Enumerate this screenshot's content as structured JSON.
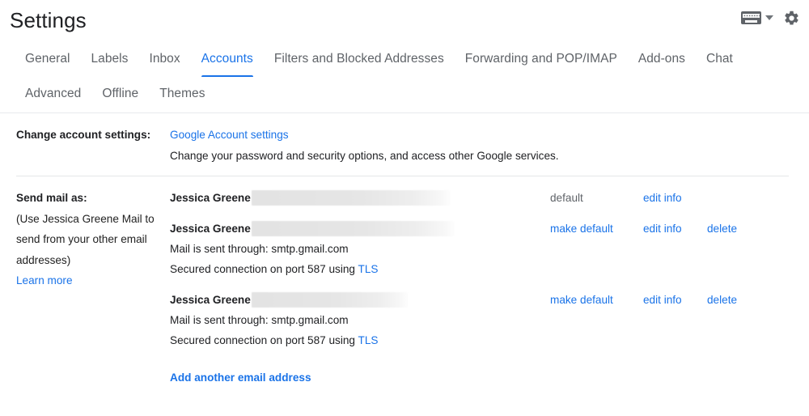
{
  "header": {
    "title": "Settings",
    "keyboard_icon": "keyboard-icon",
    "keyboard_dropdown_icon": "chevron-down-icon",
    "gear_icon": "gear-icon"
  },
  "tabs": [
    {
      "label": "General",
      "active": false
    },
    {
      "label": "Labels",
      "active": false
    },
    {
      "label": "Inbox",
      "active": false
    },
    {
      "label": "Accounts",
      "active": true
    },
    {
      "label": "Filters and Blocked Addresses",
      "active": false
    },
    {
      "label": "Forwarding and POP/IMAP",
      "active": false
    },
    {
      "label": "Add-ons",
      "active": false
    },
    {
      "label": "Chat",
      "active": false
    },
    {
      "label": "Advanced",
      "active": false
    },
    {
      "label": "Offline",
      "active": false
    },
    {
      "label": "Themes",
      "active": false
    }
  ],
  "change_account": {
    "label": "Change account settings:",
    "link": "Google Account settings",
    "description": "Change your password and security options, and access other Google services."
  },
  "send_mail_as": {
    "label": "Send mail as:",
    "note": "(Use Jessica Greene Mail to send from your other email addresses)",
    "learn_more": "Learn more",
    "add_another": "Add another email address",
    "accounts": [
      {
        "name": "Jessica Greene",
        "address_redacted": true,
        "redaction_width": 245,
        "default_text": "default",
        "make_default": "",
        "edit_info": "edit info",
        "delete": "",
        "smtp_line": "",
        "secure_line_prefix": "",
        "secure_line_link": ""
      },
      {
        "name": "Jessica Greene",
        "address_redacted": true,
        "redaction_width": 250,
        "default_text": "",
        "make_default": "make default",
        "edit_info": "edit info",
        "delete": "delete",
        "smtp_line": "Mail is sent through: smtp.gmail.com",
        "secure_line_prefix": "Secured connection on port 587 using ",
        "secure_line_link": "TLS"
      },
      {
        "name": "Jessica Greene",
        "address_redacted": true,
        "redaction_width": 193,
        "default_text": "",
        "make_default": "make default",
        "edit_info": "edit info",
        "delete": "delete",
        "smtp_line": "Mail is sent through: smtp.gmail.com",
        "secure_line_prefix": "Secured connection on port 587 using ",
        "secure_line_link": "TLS"
      }
    ]
  },
  "colors": {
    "accent_blue": "#1a73e8",
    "text_primary": "#202124",
    "text_secondary": "#5f6368",
    "divider": "#e8eaed"
  }
}
